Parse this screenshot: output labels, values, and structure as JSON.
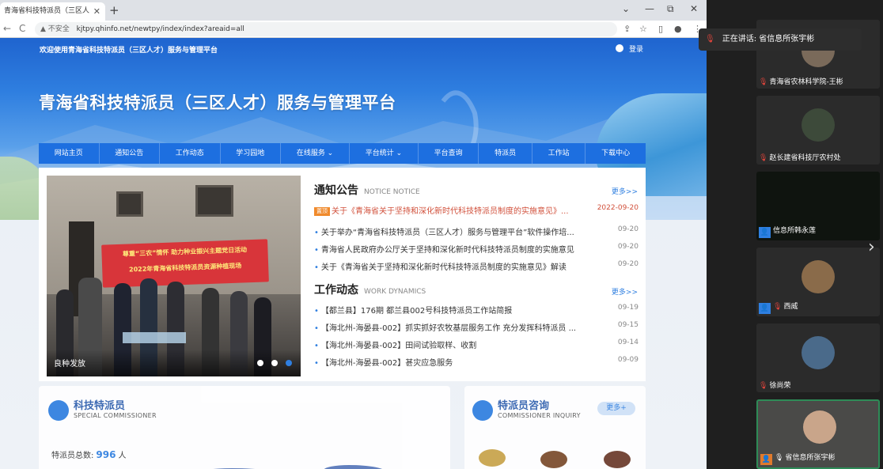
{
  "browser": {
    "tab_title": "青海省科技特派员（三区人才）",
    "tab_close": "✕",
    "new_tab": "+",
    "window_controls": [
      "⌄",
      "—",
      "⧉",
      "✕"
    ],
    "nav": [
      "←",
      "→",
      "C"
    ],
    "security": "▲ 不安全",
    "url": "kjtpy.qhinfo.net/newtpy/index/index?areaid=all",
    "toolbar_icons": [
      "share-icon",
      "star-icon",
      "sidebar-icon",
      "profile-icon",
      "menu-icon"
    ]
  },
  "page": {
    "welcome": "欢迎使用青海省科技特派员（三区人才）服务与管理平台",
    "login": "登录",
    "site_title": "青海省科技特派员（三区人才）服务与管理平台",
    "nav_items": [
      "网站主页",
      "通知公告",
      "工作动态",
      "学习园地",
      "在线服务 ⌄",
      "平台统计 ⌄",
      "平台查询",
      "特派员",
      "工作站",
      "下载中心"
    ],
    "slider": {
      "banner_text1": "尊重“三农”情怀 助力种业振兴主题党日活动",
      "banner_text2": "2022年青海省科技特派员资源种植现场",
      "caption": "良种发放",
      "active_dot": 3,
      "dot_count": 3
    },
    "notice": {
      "title": "通知公告",
      "title_en": "NOTICE NOTICE",
      "more": "更多>>",
      "top": {
        "badge": "置顶",
        "text": "关于《青海省关于坚持和深化新时代科技特派员制度的实施意见》...",
        "date": "2022-09-20"
      },
      "items": [
        {
          "text": "关于举办“青海省科技特派员（三区人才）服务与管理平台”软件操作培...",
          "date": "09-20"
        },
        {
          "text": "青海省人民政府办公厅关于坚持和深化新时代科技特派员制度的实施意见",
          "date": "09-20"
        },
        {
          "text": "关于《青海省关于坚持和深化新时代科技特派员制度的实施意见》解读",
          "date": "09-20"
        }
      ]
    },
    "dynamics": {
      "title": "工作动态",
      "title_en": "WORK DYNAMICS",
      "more": "更多>>",
      "items": [
        {
          "text": "【都兰县】176期 都兰县002号科技特派员工作站简报",
          "date": "09-19"
        },
        {
          "text": "【海北州-海晏县-002】抓实抓好农牧基层服务工作 充分发挥科特派员 ...",
          "date": "09-15"
        },
        {
          "text": "【海北州-海晏县-002】田间试验取样、收割",
          "date": "09-14"
        },
        {
          "text": "【海北州-海晏县-002】甚灾应急服务",
          "date": "09-09"
        }
      ]
    },
    "commissioner": {
      "title": "科技特派员",
      "subtitle": "SPECIAL COMMISSIONER",
      "stat_label": "特派员总数:",
      "stat_value": "996",
      "stat_unit": "人"
    },
    "inquiry": {
      "title": "特派员咨询",
      "subtitle": "COMMISSIONER INQUIRY",
      "more": "更多+"
    }
  },
  "meeting": {
    "speaking": "正在讲话: 省信息所张宇彬",
    "participants": [
      {
        "name": "青海省农林科学院-王彬",
        "icon": "mic-off-icon"
      },
      {
        "name": "赵长建省科技厅农村处",
        "icon": "mic-off-icon"
      },
      {
        "name": "信息所韩永莲",
        "icon": "user-icon"
      },
      {
        "name": "西威",
        "icon": "user-icon"
      },
      {
        "name": "徐尚荣",
        "icon": "mic-off-icon"
      },
      {
        "name": "省信息所张宇彬",
        "icon": "user-icon"
      }
    ],
    "next_arrow": "›"
  },
  "colors": {
    "accent": "#2f7fe0",
    "nav_bar": "#1d6fe0",
    "top_notice": "#d1503b",
    "mic_muted": "#e2453c",
    "sidebar_bg": "#1f1f1f"
  }
}
